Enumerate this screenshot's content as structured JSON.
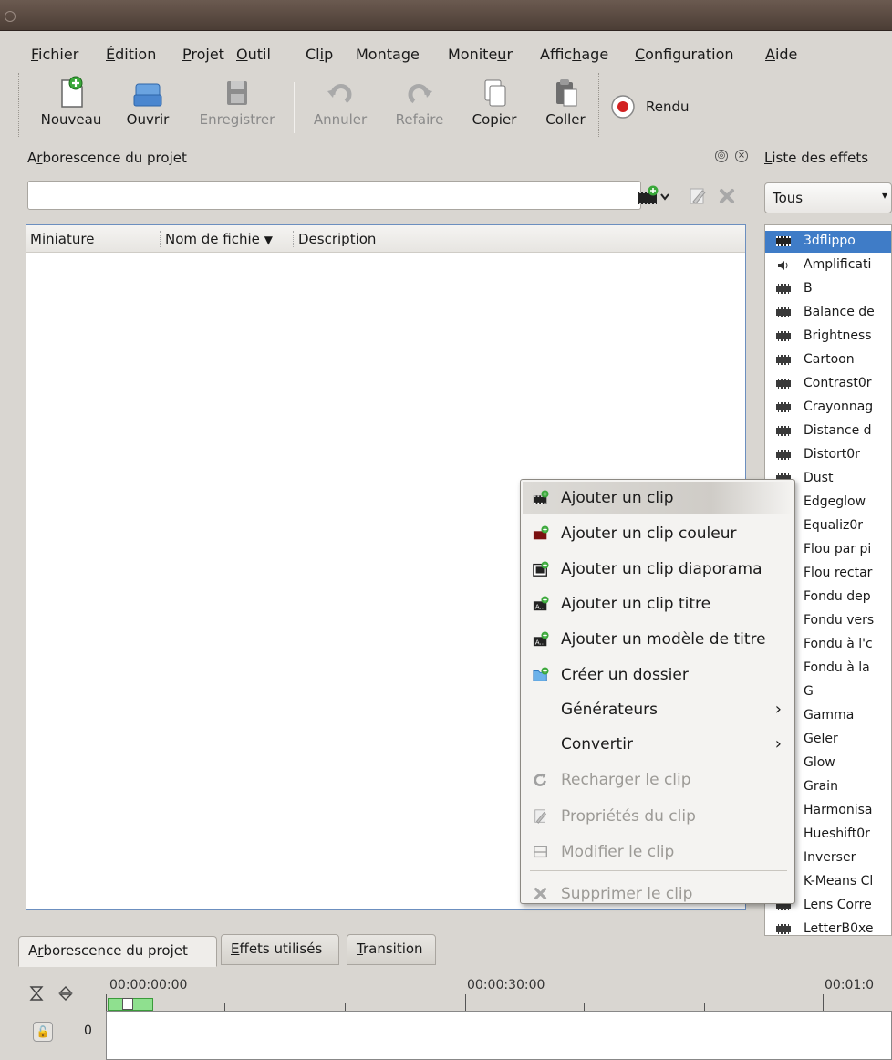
{
  "menubar": {
    "items": [
      {
        "pre": "",
        "u": "F",
        "post": "ichier"
      },
      {
        "pre": "",
        "u": "É",
        "post": "dition"
      },
      {
        "pre": "",
        "u": "P",
        "post": "rojet"
      },
      {
        "pre": "",
        "u": "O",
        "post": "util"
      },
      {
        "pre": "Cl",
        "u": "i",
        "post": "p"
      },
      {
        "pre": "Monta",
        "u": "g",
        "post": "e"
      },
      {
        "pre": "Monite",
        "u": "u",
        "post": "r"
      },
      {
        "pre": "Affic",
        "u": "h",
        "post": "age"
      },
      {
        "pre": "",
        "u": "C",
        "post": "onfiguration"
      },
      {
        "pre": "",
        "u": "A",
        "post": "ide"
      }
    ]
  },
  "toolbar": {
    "new_label": "Nouveau",
    "open_label": "Ouvrir",
    "save_label": "Enregistrer",
    "undo_label": "Annuler",
    "redo_label": "Refaire",
    "copy_label": "Copier",
    "paste_label": "Coller",
    "render_label": "Rendu"
  },
  "project_tree": {
    "title_pre": "A",
    "title_u": "r",
    "title_post": "borescence du projet",
    "search_value": "",
    "columns": [
      "Miniature",
      "Nom de fichie",
      "Description"
    ]
  },
  "bottom_tabs": [
    {
      "pre": "A",
      "u": "r",
      "post": "borescence du projet"
    },
    {
      "pre": "",
      "u": "E",
      "post": "ffets utilisés"
    },
    {
      "pre": "",
      "u": "T",
      "post": "ransition"
    }
  ],
  "effects_panel": {
    "title_u": "L",
    "title_post": "iste des effets",
    "filter_value": "Tous",
    "items": [
      {
        "label": "3dflippo",
        "icon": "video",
        "selected": true
      },
      {
        "label": "Amplificati",
        "icon": "audio"
      },
      {
        "label": "B",
        "icon": "video"
      },
      {
        "label": "Balance de",
        "icon": "video"
      },
      {
        "label": "Brightness",
        "icon": "video"
      },
      {
        "label": "Cartoon",
        "icon": "video"
      },
      {
        "label": "Contrast0r",
        "icon": "video"
      },
      {
        "label": "Crayonnag",
        "icon": "video"
      },
      {
        "label": "Distance d",
        "icon": "video"
      },
      {
        "label": "Distort0r",
        "icon": "video"
      },
      {
        "label": "Dust",
        "icon": "video"
      },
      {
        "label": "Edgeglow",
        "icon": "video"
      },
      {
        "label": "Equaliz0r",
        "icon": "video"
      },
      {
        "label": "Flou par pi",
        "icon": "video"
      },
      {
        "label": "Flou rectar",
        "icon": "video"
      },
      {
        "label": "Fondu dep",
        "icon": "video"
      },
      {
        "label": "Fondu vers",
        "icon": "video"
      },
      {
        "label": "Fondu à l'c",
        "icon": "video"
      },
      {
        "label": "Fondu à la",
        "icon": "video"
      },
      {
        "label": "G",
        "icon": "video"
      },
      {
        "label": "Gamma",
        "icon": "video"
      },
      {
        "label": "Geler",
        "icon": "video"
      },
      {
        "label": "Glow",
        "icon": "video"
      },
      {
        "label": "Grain",
        "icon": "video"
      },
      {
        "label": "Harmonisa",
        "icon": "video"
      },
      {
        "label": "Hueshift0r",
        "icon": "video"
      },
      {
        "label": "Inverser",
        "icon": "video"
      },
      {
        "label": "K-Means Cl",
        "icon": "video"
      },
      {
        "label": "Lens Corre",
        "icon": "video"
      },
      {
        "label": "LetterB0xe",
        "icon": "video"
      }
    ]
  },
  "context_menu": {
    "items": [
      {
        "label": "Ajouter un clip",
        "icon": "add-clip-icon",
        "hover": true
      },
      {
        "label": "Ajouter un clip couleur",
        "icon": "add-color-clip-icon"
      },
      {
        "label": "Ajouter un clip diaporama",
        "icon": "add-slideshow-clip-icon"
      },
      {
        "label": "Ajouter un clip titre",
        "icon": "add-title-clip-icon"
      },
      {
        "label": "Ajouter un modèle de titre",
        "icon": "add-title-template-icon"
      },
      {
        "label": "Créer un dossier",
        "icon": "create-folder-icon"
      },
      {
        "label": "Générateurs",
        "submenu": true
      },
      {
        "label": "Convertir",
        "submenu": true
      },
      {
        "label": "Recharger le clip",
        "icon": "reload-icon",
        "disabled": true
      },
      {
        "label": "Propriétés du clip",
        "icon": "edit-icon",
        "disabled": true
      },
      {
        "label": "Modifier le clip",
        "icon": "modify-icon",
        "disabled": true
      },
      {
        "label": "Supprimer le clip",
        "icon": "delete-icon",
        "disabled": true
      }
    ]
  },
  "timeline": {
    "timecodes": [
      "00:00:00:00",
      "00:00:30:00",
      "00:01:0"
    ],
    "track_number": "0"
  },
  "colors": {
    "accent": "#3f7cc7",
    "titlebar": "#5a4a42",
    "panel_bg": "#d9d6d1"
  }
}
